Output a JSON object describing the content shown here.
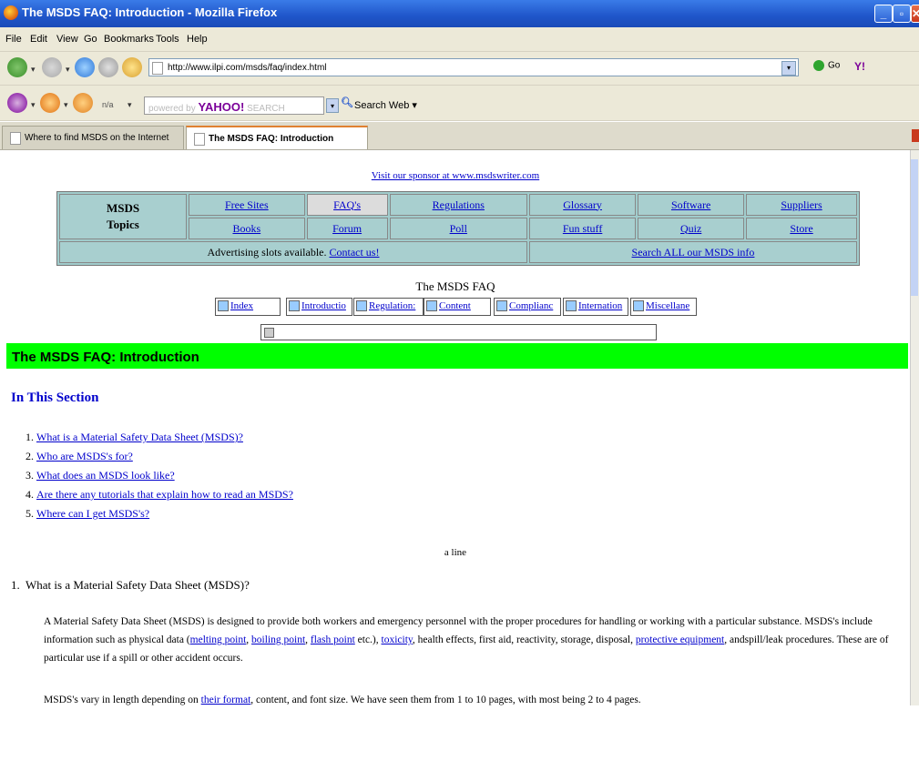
{
  "window": {
    "title": "The MSDS FAQ: Introduction - Mozilla Firefox"
  },
  "menu": [
    "File",
    "Edit",
    "View",
    "Go",
    "Bookmarks",
    "Tools",
    "Help"
  ],
  "nav": {
    "url": "http://www.ilpi.com/msds/faq/index.html",
    "go_label": "Go",
    "yahoo_btn": "Y!"
  },
  "yahoo_toolbar": {
    "na_label": "n/a",
    "powered": "powered by",
    "brand": "YAHOO!",
    "search_placeholder": "SEARCH",
    "search_web": "Search Web ▾"
  },
  "tabs": [
    {
      "label": "Where to find MSDS on the Internet"
    },
    {
      "label": "The MSDS FAQ: Introduction"
    }
  ],
  "page": {
    "sponsor": "Visit our sponsor at www.msdswriter.com",
    "topics": {
      "header_line1": "MSDS",
      "header_line2": "Topics",
      "row1": [
        "Free Sites",
        "FAQ's",
        "Regulations",
        "Glossary",
        "Software",
        "Suppliers"
      ],
      "row2": [
        "Books",
        "Forum",
        "Poll",
        "Fun stuff",
        "Quiz",
        "Store"
      ],
      "advert_text": "Advertising slots available.",
      "advert_link": "Contact us!",
      "search_all": "Search ALL our MSDS info"
    },
    "faq_title": "The MSDS FAQ",
    "faq_buttons": [
      "Index",
      "Introductio",
      "Regulation:",
      "Content",
      "Complianc",
      "Internation",
      "Miscellane"
    ],
    "heading": "The MSDS FAQ: Introduction",
    "in_section": "In This Section",
    "toc": [
      "What is a Material Safety Data Sheet (MSDS)?",
      "Who are MSDS's for?",
      "What does an MSDS look like?",
      "Are there any tutorials that explain how to read an MSDS?",
      "Where can I get MSDS's?"
    ],
    "a_line": "a line",
    "q1": {
      "title": "What is a Material Safety Data Sheet (MSDS)?",
      "p1_a": "A Material Safety Data Sheet (MSDS) is designed to provide both workers and emergency personnel with the proper procedures for handling or working with a particular substance. MSDS's include information such as physical data (",
      "link_melting": "melting point",
      "sep1": ", ",
      "link_boiling": "boiling point",
      "sep2": ", ",
      "link_flash": "flash point",
      "p1_b": " etc.), ",
      "link_toxicity": "toxicity",
      "p1_c": ", health effects, first aid, reactivity, storage, disposal, ",
      "link_protective": "protective equipment",
      "p1_d": ", andspill/leak procedures. These are of particular use if a spill or other accident occurs.",
      "p2_a": "MSDS's vary in length depending on ",
      "link_format": "their format",
      "p2_b": ", content, and font size. We have seen them from 1 to 10 pages, with most being 2 to 4 pages."
    }
  }
}
